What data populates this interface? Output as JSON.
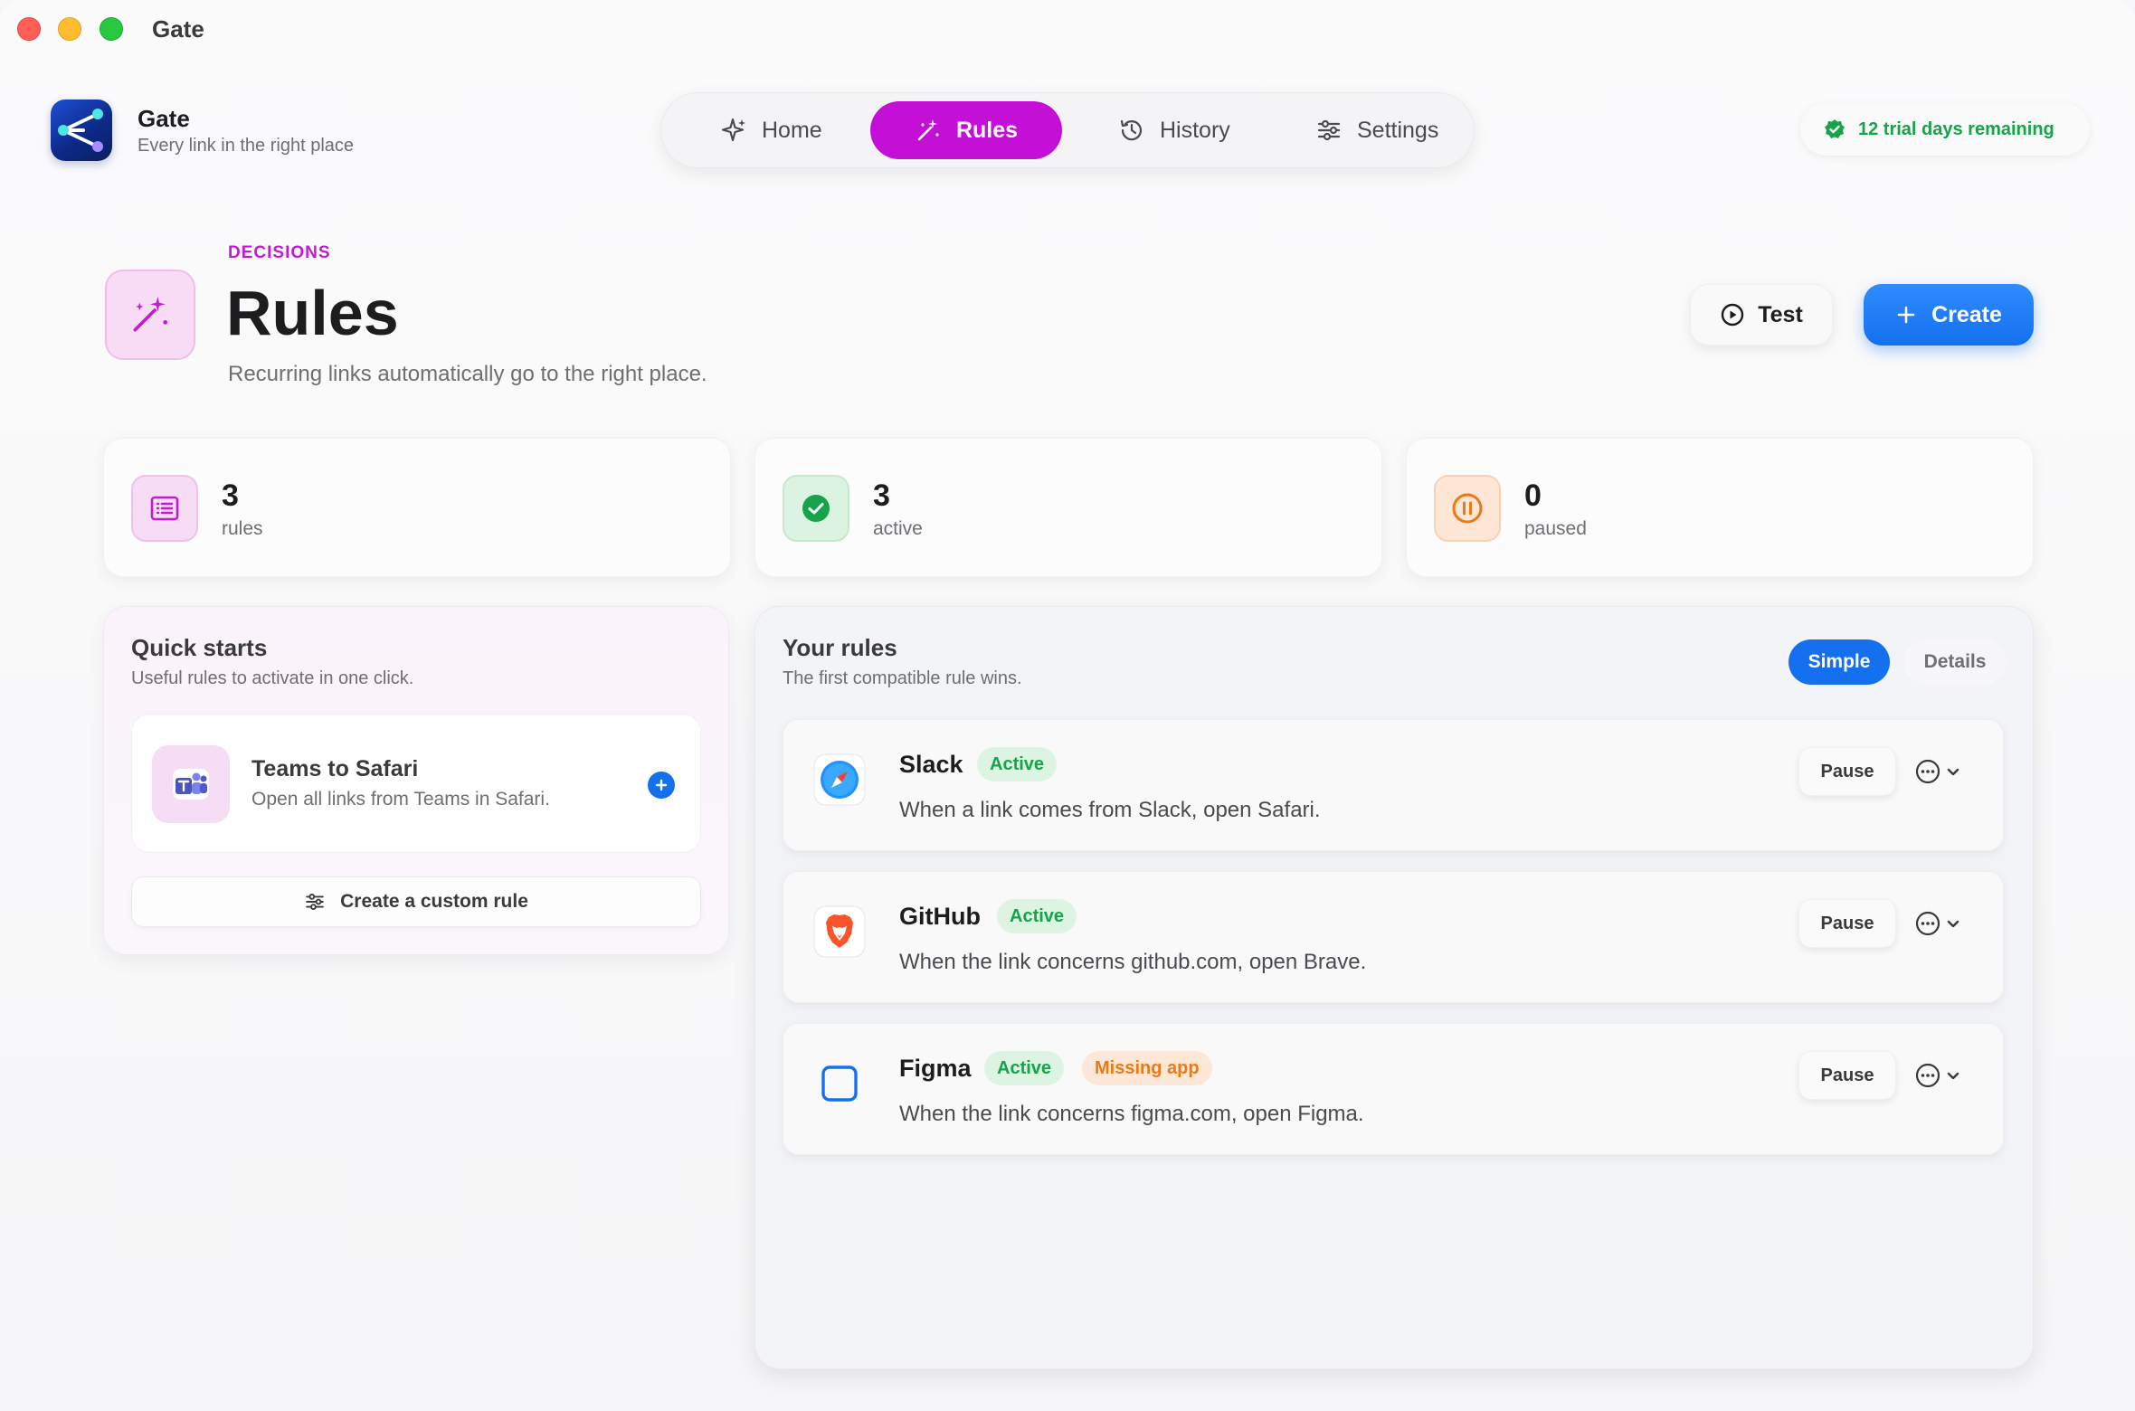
{
  "window": {
    "title": "Gate"
  },
  "brand": {
    "name": "Gate",
    "tagline": "Every link in the right place"
  },
  "nav": {
    "items": [
      {
        "label": "Home",
        "icon": "sparkles-icon"
      },
      {
        "label": "Rules",
        "icon": "magic-wand-icon",
        "selected": true
      },
      {
        "label": "History",
        "icon": "history-clock-icon"
      },
      {
        "label": "Settings",
        "icon": "sliders-icon"
      }
    ]
  },
  "trial": {
    "label": "12 trial days remaining",
    "color": "#16a34a"
  },
  "header": {
    "eyebrow": "DECISIONS",
    "title": "Rules",
    "subtitle": "Recurring links automatically go to the right place.",
    "test_label": "Test",
    "create_label": "Create"
  },
  "stats": [
    {
      "value": "3",
      "label": "rules",
      "icon": "list-icon"
    },
    {
      "value": "3",
      "label": "active",
      "icon": "check-circle-icon"
    },
    {
      "value": "0",
      "label": "paused",
      "icon": "pause-circle-icon"
    }
  ],
  "quick_starts": {
    "title": "Quick starts",
    "subtitle": "Useful rules to activate in one click.",
    "items": [
      {
        "title": "Teams to Safari",
        "description": "Open all links from Teams in Safari.",
        "icon": "teams-icon"
      }
    ],
    "custom_label": "Create a custom rule"
  },
  "your_rules": {
    "title": "Your rules",
    "subtitle": "The first compatible rule wins.",
    "view_simple": "Simple",
    "view_details": "Details",
    "rules": [
      {
        "name": "Slack",
        "badges": [
          "Active"
        ],
        "description": "When a link comes from Slack, open Safari.",
        "icon": "safari-icon",
        "pause_label": "Pause"
      },
      {
        "name": "GitHub",
        "badges": [
          "Active"
        ],
        "description": "When the link concerns github.com, open Brave.",
        "icon": "brave-icon",
        "pause_label": "Pause"
      },
      {
        "name": "Figma",
        "badges": [
          "Active",
          "Missing app"
        ],
        "description": "When the link concerns figma.com, open Figma.",
        "icon": "missing-app-icon",
        "pause_label": "Pause"
      }
    ]
  },
  "colors": {
    "accent": "#c410d6",
    "primary": "#1570ef",
    "success": "#16a34a",
    "warning": "#ea7a16"
  }
}
